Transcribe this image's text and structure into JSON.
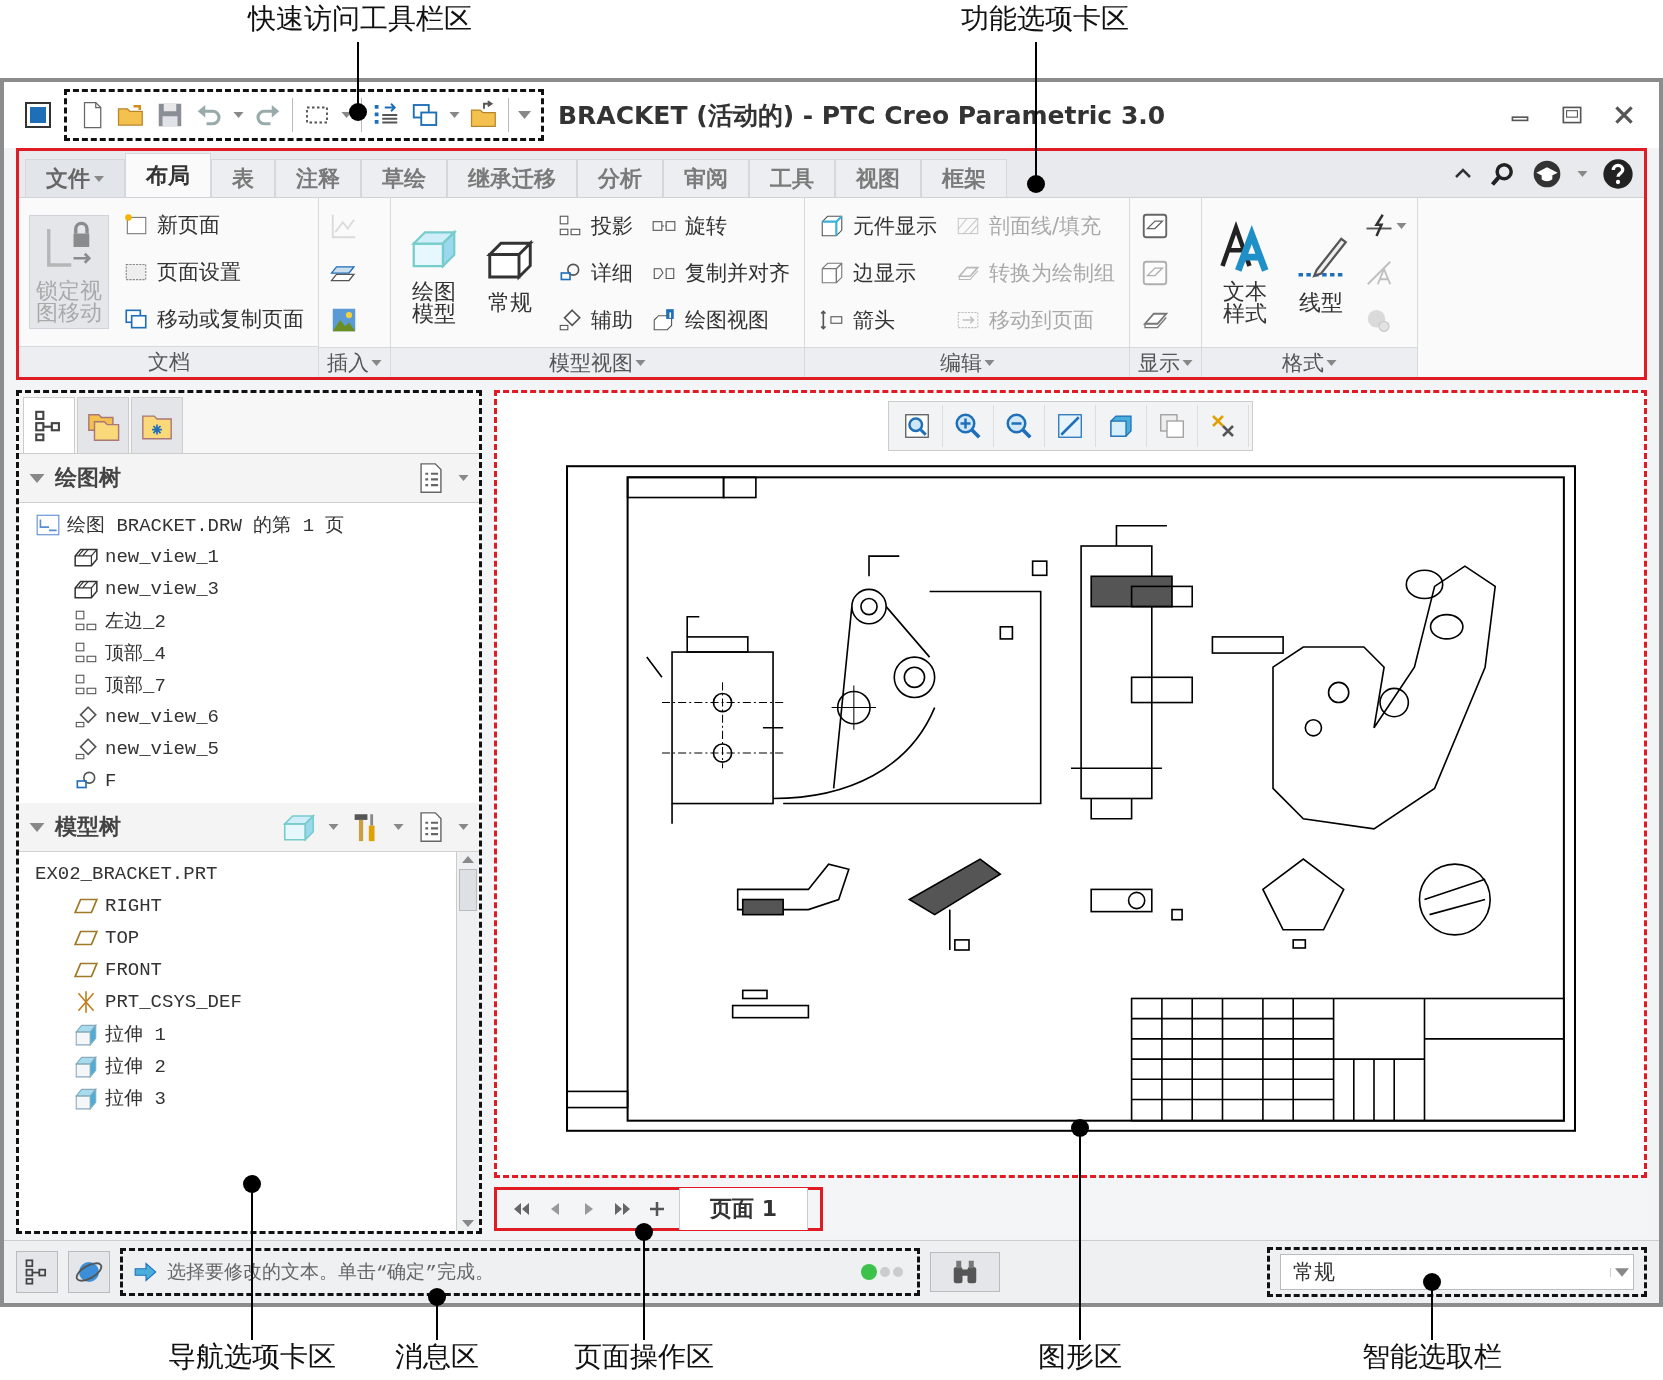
{
  "annotations": {
    "top": [
      "快速访问工具栏区",
      "功能选项卡区"
    ],
    "bottom": [
      "导航选项卡区",
      "消息区",
      "页面操作区",
      "图形区",
      "智能选取栏"
    ]
  },
  "window": {
    "title": "BRACKET (活动的) - PTC Creo Parametric 3.0"
  },
  "ribbon": {
    "tabs": [
      {
        "label": "文件",
        "kind": "menu",
        "selected": false
      },
      {
        "label": "布局",
        "kind": "tab",
        "selected": true
      },
      {
        "label": "表",
        "kind": "tab",
        "selected": false
      },
      {
        "label": "注释",
        "kind": "tab",
        "selected": false
      },
      {
        "label": "草绘",
        "kind": "tab",
        "selected": false
      },
      {
        "label": "继承迁移",
        "kind": "tab",
        "selected": false
      },
      {
        "label": "分析",
        "kind": "tab",
        "selected": false
      },
      {
        "label": "审阅",
        "kind": "tab",
        "selected": false
      },
      {
        "label": "工具",
        "kind": "tab",
        "selected": false
      },
      {
        "label": "视图",
        "kind": "tab",
        "selected": false
      },
      {
        "label": "框架",
        "kind": "tab",
        "selected": false
      }
    ],
    "groups": [
      {
        "label": "文档",
        "menu": false,
        "columns": [
          {
            "kind": "large",
            "items": [
              {
                "label": "锁定视图移动",
                "disabled": true
              }
            ]
          },
          {
            "kind": "stack",
            "items": [
              {
                "label": "新页面",
                "disabled": false
              },
              {
                "label": "页面设置",
                "disabled": false
              },
              {
                "label": "移动或复制页面",
                "disabled": false
              }
            ]
          }
        ]
      },
      {
        "label": "插入",
        "menu": true,
        "columns": [
          {
            "kind": "icons",
            "items": [
              {
                "disabled": true
              },
              {
                "disabled": false
              },
              {
                "disabled": false
              }
            ]
          }
        ]
      },
      {
        "label": "模型视图",
        "menu": true,
        "columns": [
          {
            "kind": "large",
            "items": [
              {
                "label": "绘图模型",
                "disabled": false
              }
            ]
          },
          {
            "kind": "large",
            "items": [
              {
                "label": "常规",
                "disabled": false
              }
            ]
          },
          {
            "kind": "stack",
            "items": [
              {
                "label": "投影",
                "disabled": false
              },
              {
                "label": "详细",
                "disabled": false
              },
              {
                "label": "辅助",
                "disabled": false
              }
            ]
          },
          {
            "kind": "stack",
            "items": [
              {
                "label": "旋转",
                "disabled": false
              },
              {
                "label": "复制并对齐",
                "disabled": false
              },
              {
                "label": "绘图视图",
                "disabled": false
              }
            ]
          }
        ]
      },
      {
        "label": "编辑",
        "menu": true,
        "columns": [
          {
            "kind": "stack",
            "items": [
              {
                "label": "元件显示",
                "disabled": false
              },
              {
                "label": "边显示",
                "disabled": false
              },
              {
                "label": "箭头",
                "disabled": false
              }
            ]
          },
          {
            "kind": "stack",
            "items": [
              {
                "label": "剖面线/填充",
                "disabled": true
              },
              {
                "label": "转换为绘制组",
                "disabled": true
              },
              {
                "label": "移动到页面",
                "disabled": true
              }
            ]
          }
        ]
      },
      {
        "label": "显示",
        "menu": true,
        "columns": [
          {
            "kind": "icons",
            "items": [
              {
                "disabled": false
              },
              {
                "disabled": true
              },
              {
                "disabled": false
              }
            ]
          }
        ]
      },
      {
        "label": "格式",
        "menu": true,
        "columns": [
          {
            "kind": "large",
            "items": [
              {
                "label": "文本样式",
                "disabled": false
              }
            ]
          },
          {
            "kind": "large",
            "items": [
              {
                "label": "线型",
                "disabled": false
              }
            ]
          },
          {
            "kind": "icons",
            "items": [
              {
                "disabled": false,
                "menu": true
              },
              {
                "disabled": true
              },
              {
                "disabled": true
              }
            ]
          }
        ]
      }
    ]
  },
  "nav": {
    "tabs": [
      {
        "selected": true
      },
      {
        "selected": false
      },
      {
        "selected": false
      }
    ],
    "drawing_tree": {
      "title": "绘图树",
      "expanded": true,
      "items": [
        {
          "label": "绘图 BRACKET.DRW 的第 1 页",
          "kind": "sheet",
          "children": [
            {
              "label": "new_view_1",
              "kind": "general"
            },
            {
              "label": "new_view_3",
              "kind": "general"
            },
            {
              "label": "左边_2",
              "kind": "projection"
            },
            {
              "label": "顶部_4",
              "kind": "projection"
            },
            {
              "label": "顶部_7",
              "kind": "projection"
            },
            {
              "label": "new_view_6",
              "kind": "auxiliary"
            },
            {
              "label": "new_view_5",
              "kind": "auxiliary"
            },
            {
              "label": "F",
              "kind": "detail"
            }
          ]
        }
      ]
    },
    "model_tree": {
      "title": "模型树",
      "expanded": true,
      "items": [
        {
          "label": "EX02_BRACKET.PRT",
          "children": [
            {
              "label": "RIGHT",
              "kind": "plane"
            },
            {
              "label": "TOP",
              "kind": "plane"
            },
            {
              "label": "FRONT",
              "kind": "plane"
            },
            {
              "label": "PRT_CSYS_DEF",
              "kind": "csys"
            },
            {
              "label": "拉伸 1",
              "kind": "extrude"
            },
            {
              "label": "拉伸 2",
              "kind": "extrude"
            },
            {
              "label": "拉伸 3",
              "kind": "extrude"
            }
          ]
        }
      ]
    }
  },
  "graphics": {
    "page_tabs": [
      {
        "label": "页面 1",
        "selected": true
      }
    ]
  },
  "status": {
    "message": "选择要修改的文本。单击“确定”完成。",
    "smart_select": {
      "value": "常规"
    }
  }
}
